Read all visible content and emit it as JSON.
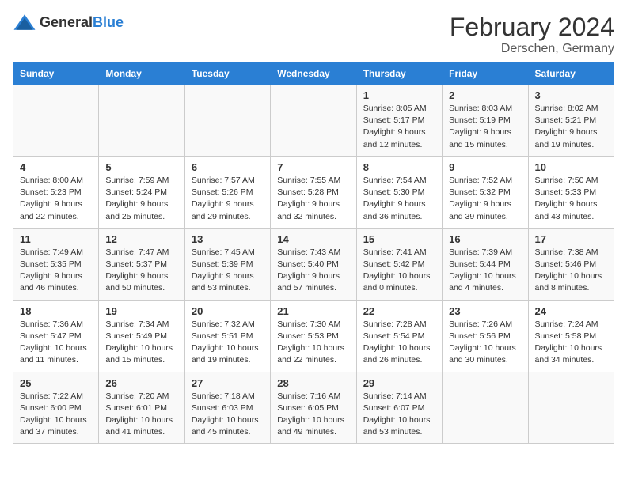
{
  "logo": {
    "general": "General",
    "blue": "Blue"
  },
  "title": "February 2024",
  "subtitle": "Derschen, Germany",
  "days_of_week": [
    "Sunday",
    "Monday",
    "Tuesday",
    "Wednesday",
    "Thursday",
    "Friday",
    "Saturday"
  ],
  "weeks": [
    [
      {
        "day": "",
        "info": ""
      },
      {
        "day": "",
        "info": ""
      },
      {
        "day": "",
        "info": ""
      },
      {
        "day": "",
        "info": ""
      },
      {
        "day": "1",
        "info": "Sunrise: 8:05 AM\nSunset: 5:17 PM\nDaylight: 9 hours\nand 12 minutes."
      },
      {
        "day": "2",
        "info": "Sunrise: 8:03 AM\nSunset: 5:19 PM\nDaylight: 9 hours\nand 15 minutes."
      },
      {
        "day": "3",
        "info": "Sunrise: 8:02 AM\nSunset: 5:21 PM\nDaylight: 9 hours\nand 19 minutes."
      }
    ],
    [
      {
        "day": "4",
        "info": "Sunrise: 8:00 AM\nSunset: 5:23 PM\nDaylight: 9 hours\nand 22 minutes."
      },
      {
        "day": "5",
        "info": "Sunrise: 7:59 AM\nSunset: 5:24 PM\nDaylight: 9 hours\nand 25 minutes."
      },
      {
        "day": "6",
        "info": "Sunrise: 7:57 AM\nSunset: 5:26 PM\nDaylight: 9 hours\nand 29 minutes."
      },
      {
        "day": "7",
        "info": "Sunrise: 7:55 AM\nSunset: 5:28 PM\nDaylight: 9 hours\nand 32 minutes."
      },
      {
        "day": "8",
        "info": "Sunrise: 7:54 AM\nSunset: 5:30 PM\nDaylight: 9 hours\nand 36 minutes."
      },
      {
        "day": "9",
        "info": "Sunrise: 7:52 AM\nSunset: 5:32 PM\nDaylight: 9 hours\nand 39 minutes."
      },
      {
        "day": "10",
        "info": "Sunrise: 7:50 AM\nSunset: 5:33 PM\nDaylight: 9 hours\nand 43 minutes."
      }
    ],
    [
      {
        "day": "11",
        "info": "Sunrise: 7:49 AM\nSunset: 5:35 PM\nDaylight: 9 hours\nand 46 minutes."
      },
      {
        "day": "12",
        "info": "Sunrise: 7:47 AM\nSunset: 5:37 PM\nDaylight: 9 hours\nand 50 minutes."
      },
      {
        "day": "13",
        "info": "Sunrise: 7:45 AM\nSunset: 5:39 PM\nDaylight: 9 hours\nand 53 minutes."
      },
      {
        "day": "14",
        "info": "Sunrise: 7:43 AM\nSunset: 5:40 PM\nDaylight: 9 hours\nand 57 minutes."
      },
      {
        "day": "15",
        "info": "Sunrise: 7:41 AM\nSunset: 5:42 PM\nDaylight: 10 hours\nand 0 minutes."
      },
      {
        "day": "16",
        "info": "Sunrise: 7:39 AM\nSunset: 5:44 PM\nDaylight: 10 hours\nand 4 minutes."
      },
      {
        "day": "17",
        "info": "Sunrise: 7:38 AM\nSunset: 5:46 PM\nDaylight: 10 hours\nand 8 minutes."
      }
    ],
    [
      {
        "day": "18",
        "info": "Sunrise: 7:36 AM\nSunset: 5:47 PM\nDaylight: 10 hours\nand 11 minutes."
      },
      {
        "day": "19",
        "info": "Sunrise: 7:34 AM\nSunset: 5:49 PM\nDaylight: 10 hours\nand 15 minutes."
      },
      {
        "day": "20",
        "info": "Sunrise: 7:32 AM\nSunset: 5:51 PM\nDaylight: 10 hours\nand 19 minutes."
      },
      {
        "day": "21",
        "info": "Sunrise: 7:30 AM\nSunset: 5:53 PM\nDaylight: 10 hours\nand 22 minutes."
      },
      {
        "day": "22",
        "info": "Sunrise: 7:28 AM\nSunset: 5:54 PM\nDaylight: 10 hours\nand 26 minutes."
      },
      {
        "day": "23",
        "info": "Sunrise: 7:26 AM\nSunset: 5:56 PM\nDaylight: 10 hours\nand 30 minutes."
      },
      {
        "day": "24",
        "info": "Sunrise: 7:24 AM\nSunset: 5:58 PM\nDaylight: 10 hours\nand 34 minutes."
      }
    ],
    [
      {
        "day": "25",
        "info": "Sunrise: 7:22 AM\nSunset: 6:00 PM\nDaylight: 10 hours\nand 37 minutes."
      },
      {
        "day": "26",
        "info": "Sunrise: 7:20 AM\nSunset: 6:01 PM\nDaylight: 10 hours\nand 41 minutes."
      },
      {
        "day": "27",
        "info": "Sunrise: 7:18 AM\nSunset: 6:03 PM\nDaylight: 10 hours\nand 45 minutes."
      },
      {
        "day": "28",
        "info": "Sunrise: 7:16 AM\nSunset: 6:05 PM\nDaylight: 10 hours\nand 49 minutes."
      },
      {
        "day": "29",
        "info": "Sunrise: 7:14 AM\nSunset: 6:07 PM\nDaylight: 10 hours\nand 53 minutes."
      },
      {
        "day": "",
        "info": ""
      },
      {
        "day": "",
        "info": ""
      }
    ]
  ]
}
